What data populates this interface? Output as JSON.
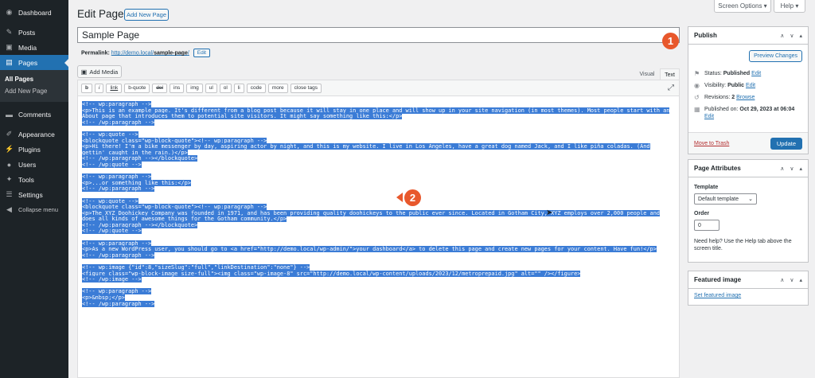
{
  "sidebar": {
    "items": [
      {
        "label": "Dashboard",
        "icon": "dashboard-icon"
      },
      {
        "label": "Posts",
        "icon": "pin-icon"
      },
      {
        "label": "Media",
        "icon": "media-icon"
      },
      {
        "label": "Pages",
        "icon": "pages-icon"
      },
      {
        "label": "Comments",
        "icon": "comment-icon"
      },
      {
        "label": "Appearance",
        "icon": "brush-icon"
      },
      {
        "label": "Plugins",
        "icon": "plug-icon"
      },
      {
        "label": "Users",
        "icon": "user-icon"
      },
      {
        "label": "Tools",
        "icon": "wrench-icon"
      },
      {
        "label": "Settings",
        "icon": "settings-icon"
      },
      {
        "label": "Collapse menu",
        "icon": "collapse-icon"
      }
    ],
    "pages_sub": [
      "All Pages",
      "Add New Page"
    ]
  },
  "top": {
    "screen_options": "Screen Options ▾",
    "help": "Help ▾"
  },
  "header": {
    "title": "Edit Page",
    "add_new": "Add New Page"
  },
  "post": {
    "title": "Sample Page",
    "permalink_label": "Permalink:",
    "permalink_base": "http://demo.local/",
    "permalink_slug": "sample-page",
    "permalink_end": "/",
    "edit": "Edit"
  },
  "editor": {
    "add_media": "Add Media",
    "tab_visual": "Visual",
    "tab_text": "Text",
    "quicktags": [
      "b",
      "i",
      "link",
      "b-quote",
      "del",
      "ins",
      "img",
      "ul",
      "ol",
      "li",
      "code",
      "more",
      "close tags"
    ],
    "code_lines": [
      "<!-- wp:paragraph -->",
      "<p>This is an example page. It's different from a blog post because it will stay in one place and will show up in your site navigation (in most themes). Most people start with an",
      "About page that introduces them to potential site visitors. It might say something like this:</p>",
      "<!-- /wp:paragraph -->",
      "",
      "<!-- wp:quote -->",
      "<blockquote class=\"wp-block-quote\"><!-- wp:paragraph -->",
      "<p>Hi there! I'm a bike messenger by day, aspiring actor by night, and this is my website. I live in Los Angeles, have a great dog named Jack, and I like piña coladas. (And",
      "gettin' caught in the rain.)</p>",
      "<!-- /wp:paragraph --></blockquote>",
      "<!-- /wp:quote -->",
      "",
      "<!-- wp:paragraph -->",
      "<p>...or something like this:</p>",
      "<!-- /wp:paragraph -->",
      "",
      "<!-- wp:quote -->",
      "<blockquote class=\"wp-block-quote\"><!-- wp:paragraph -->",
      "<p>The XYZ Doohickey Company was founded in 1971, and has been providing quality doohickeys to the public ever since. Located in Gotham City, XYZ employs over 2,000 people and",
      "does all kinds of awesome things for the Gotham community.</p>",
      "<!-- /wp:paragraph --></blockquote>",
      "<!-- /wp:quote -->",
      "",
      "<!-- wp:paragraph -->",
      "<p>As a new WordPress user, you should go to <a href=\"http://demo.local/wp-admin/\">your dashboard</a> to delete this page and create new pages for your content. Have fun!</p>",
      "<!-- /wp:paragraph -->",
      "",
      "<!-- wp:image {\"id\":8,\"sizeSlug\":\"full\",\"linkDestination\":\"none\"} -->",
      "<figure class=\"wp-block-image size-full\"><img class=\"wp-image-8\" src=\"http://demo.local/wp-content/uploads/2023/12/metroprepaid.jpg\" alt=\"\" /></figure>",
      "<!-- /wp:image -->",
      "",
      "<!-- wp:paragraph -->",
      "<p>&nbsp;</p>",
      "<!-- /wp:paragraph -->"
    ]
  },
  "publish": {
    "title": "Publish",
    "preview": "Preview Changes",
    "status_label": "Status:",
    "status_value": "Published",
    "visibility_label": "Visibility:",
    "visibility_value": "Public",
    "revisions_label": "Revisions:",
    "revisions_value": "2",
    "browse": "Browse",
    "published_on_label": "Published on:",
    "published_on_value": "Oct 29, 2023 at 06:04",
    "edit": "Edit",
    "trash": "Move to Trash",
    "update": "Update"
  },
  "attributes": {
    "title": "Page Attributes",
    "template_label": "Template",
    "template_value": "Default template",
    "order_label": "Order",
    "order_value": "0",
    "help": "Need help? Use the Help tab above the screen title."
  },
  "featured": {
    "title": "Featured image",
    "link": "Set featured image"
  },
  "markers": [
    "1",
    "2"
  ],
  "colors": {
    "accent": "#2271b1",
    "sidebar": "#1d2327",
    "selection": "#3b7cd6",
    "marker": "#e8582c"
  }
}
